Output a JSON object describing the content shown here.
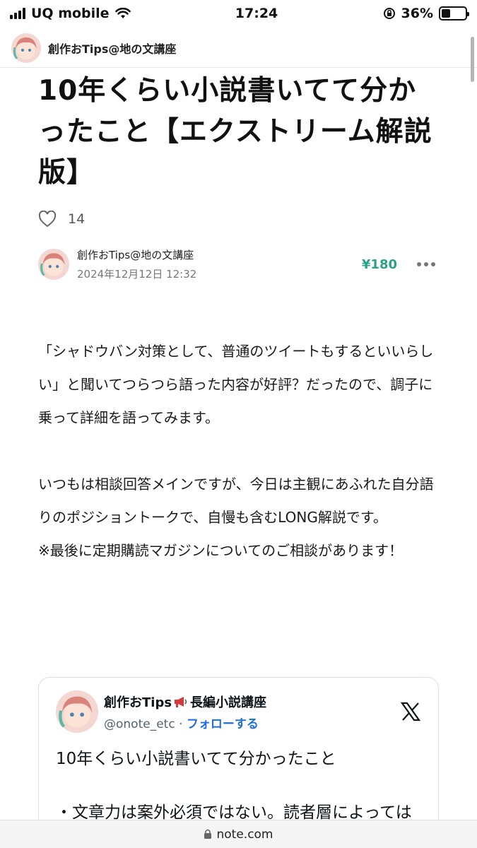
{
  "status_bar": {
    "carrier": "UQ mobile",
    "time": "17:24",
    "battery_percent": "36%",
    "battery_level": 0.36
  },
  "header": {
    "site_name": "創作おTips@地の文講座"
  },
  "article": {
    "title": "10年くらい小説書いてて分かったこと【エクストリーム解説版】",
    "like_count": "14",
    "author_name": "創作おTips@地の文講座",
    "date": "2024年12月12日 12:32",
    "price": "¥180",
    "paragraphs": [
      "「シャドウバン対策として、普通のツイートもするといいらしい」と聞いてつらつら語った内容が好評？だったので、調子に乗って詳細を語ってみます。",
      "いつもは相談回答メインですが、今日は主観にあふれた自分語りのポジショントークで、自慢も含むLONG解説です。",
      "※最後に定期購読マガジンについてのご相談があります！"
    ]
  },
  "tweet": {
    "name": "創作おTips",
    "name_suffix": "長編小説講座",
    "handle": "@onote_etc",
    "separator": "·",
    "follow_label": "フォローする",
    "text": "10年くらい小説書いてて分かったこと",
    "text2": "・文章力は案外必須ではない。読者層によっては「技術よりも、「事柄」「話を自らえこ」が"
  },
  "url_bar": {
    "domain": "note.com"
  },
  "colors": {
    "price": "#2ea08a",
    "follow": "#1d6fd6"
  }
}
